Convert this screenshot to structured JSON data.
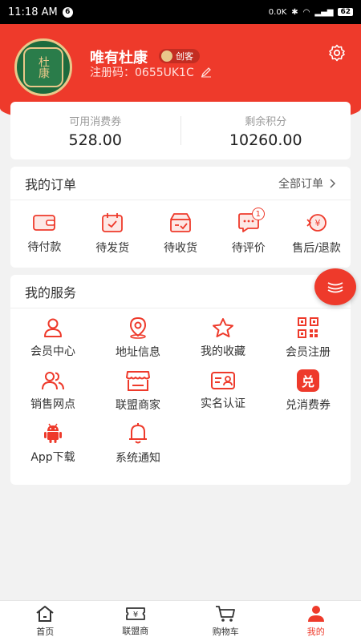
{
  "status_bar": {
    "time": "11:18 AM",
    "notif_count": "6",
    "speed": "0.0K",
    "battery": "62"
  },
  "colors": {
    "brand": "#ee3a2b",
    "gold": "#e9c88a",
    "green": "#1d6b3d"
  },
  "profile": {
    "name": "唯有杜康",
    "role": "创客",
    "reg_code": "注册码：0655UK1C",
    "avatar_glyph": "杜康"
  },
  "stats": [
    {
      "label": "可用消费券",
      "value": "528.00"
    },
    {
      "label": "剩余积分",
      "value": "10260.00"
    }
  ],
  "orders": {
    "title": "我的订单",
    "all_label": "全部订单",
    "items": [
      {
        "label": "待付款",
        "icon": "wallet-icon"
      },
      {
        "label": "待发货",
        "icon": "calendar-icon"
      },
      {
        "label": "待收货",
        "icon": "box-icon"
      },
      {
        "label": "待评价",
        "icon": "comment-icon",
        "badge": "1"
      },
      {
        "label": "售后/退款",
        "icon": "refund-icon"
      }
    ]
  },
  "services": {
    "title": "我的服务",
    "items": [
      {
        "label": "会员中心",
        "icon": "person-icon"
      },
      {
        "label": "地址信息",
        "icon": "location-icon"
      },
      {
        "label": "我的收藏",
        "icon": "star-icon"
      },
      {
        "label": "会员注册",
        "icon": "qr-icon"
      },
      {
        "label": "销售网点",
        "icon": "group-icon"
      },
      {
        "label": "联盟商家",
        "icon": "shop-icon"
      },
      {
        "label": "实名认证",
        "icon": "id-card-icon"
      },
      {
        "label": "兑消费券",
        "icon": "redeem-icon",
        "glyph": "兑"
      },
      {
        "label": "App下载",
        "icon": "android-icon"
      },
      {
        "label": "系统通知",
        "icon": "bell-icon"
      }
    ]
  },
  "tabbar": [
    {
      "label": "首页",
      "icon": "home-icon"
    },
    {
      "label": "联盟商",
      "icon": "ticket-icon"
    },
    {
      "label": "购物车",
      "icon": "cart-icon"
    },
    {
      "label": "我的",
      "icon": "user-icon",
      "active": true
    }
  ]
}
